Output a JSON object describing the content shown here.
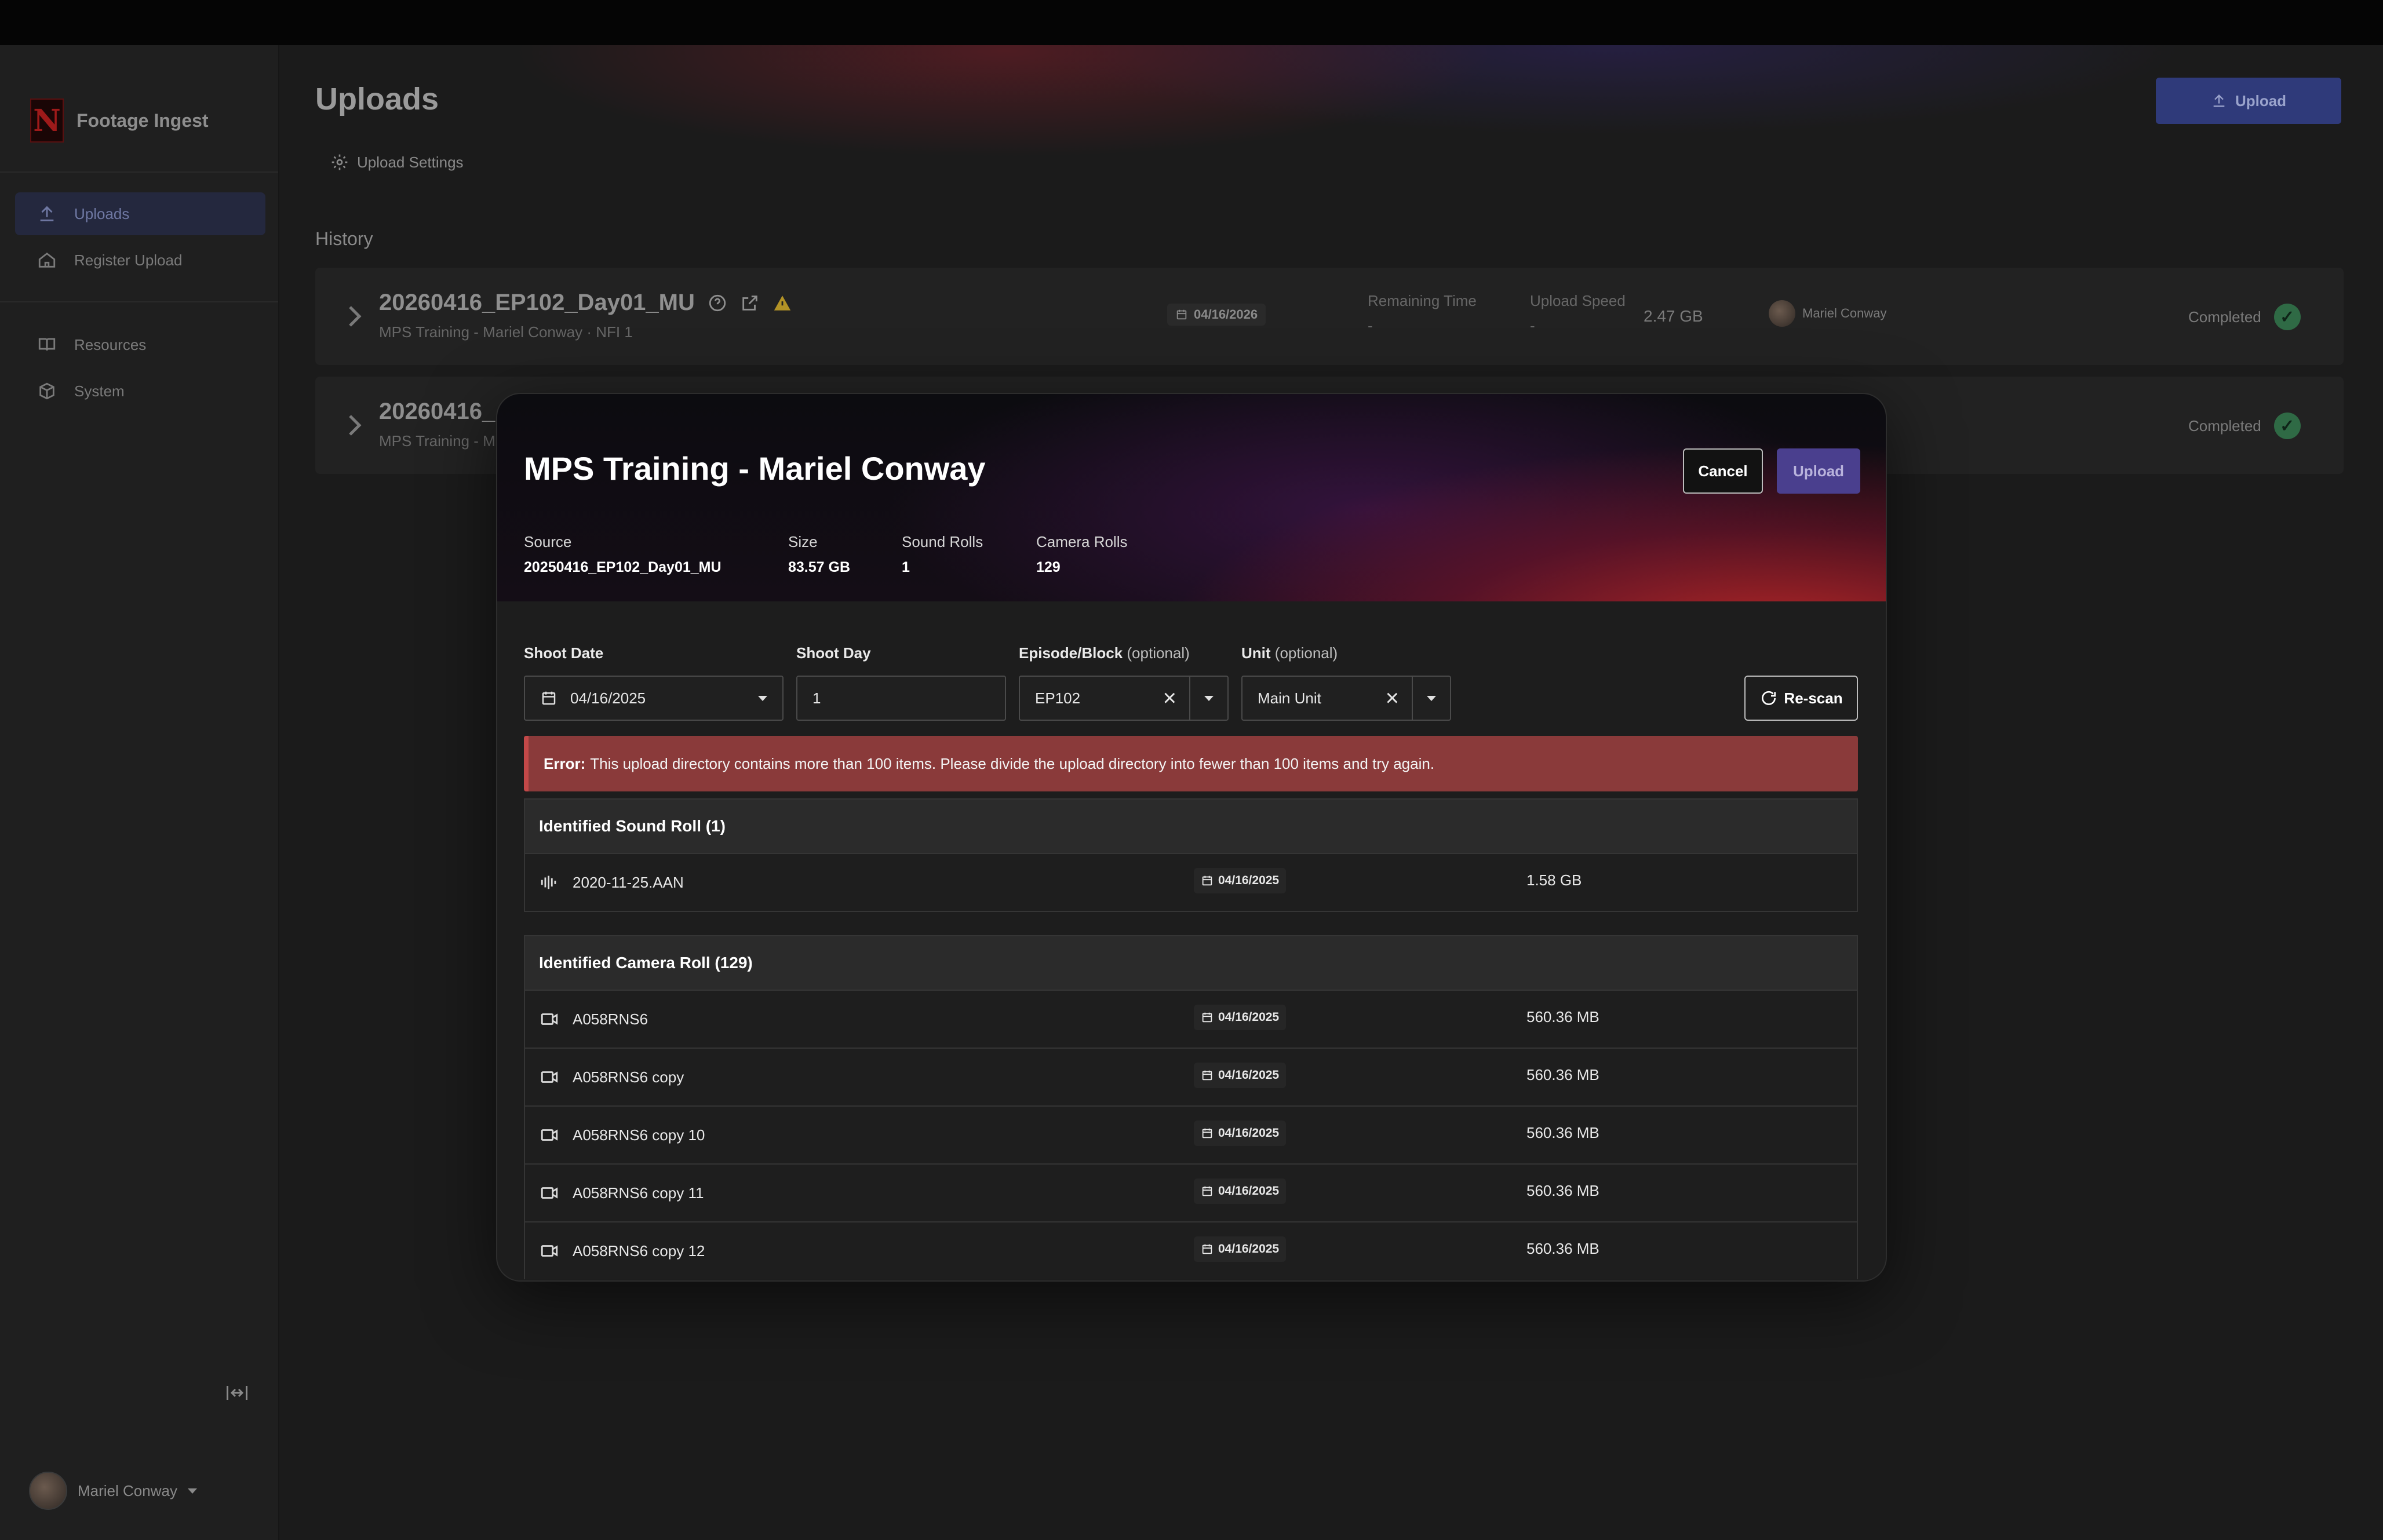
{
  "app": {
    "name": "Footage Ingest"
  },
  "sidebar": {
    "items": [
      {
        "label": "Uploads",
        "icon": "upload-icon",
        "active": true
      },
      {
        "label": "Register Upload",
        "icon": "home-icon",
        "active": false
      },
      {
        "label": "Resources",
        "icon": "book-icon",
        "active": false
      },
      {
        "label": "System",
        "icon": "cube-icon",
        "active": false
      }
    ],
    "user": "Mariel Conway"
  },
  "page": {
    "title": "Uploads",
    "upload_button": "Upload",
    "settings_label": "Upload Settings",
    "history_label": "History"
  },
  "history": [
    {
      "name": "20260416_EP102_Day01_MU",
      "subtitle": "MPS Training - Mariel Conway · NFI 1",
      "date": "04/16/2026",
      "remaining_label": "Remaining Time",
      "remaining_value": "-",
      "speed_label": "Upload Speed",
      "speed_value": "-",
      "size": "2.47 GB",
      "user": "Mariel Conway",
      "status": "Completed"
    },
    {
      "name": "20260416_",
      "subtitle": "MPS Training - M",
      "status": "Completed"
    }
  ],
  "modal": {
    "title": "MPS Training - Mariel Conway",
    "cancel": "Cancel",
    "upload": "Upload",
    "meta": {
      "source_label": "Source",
      "source_value": "20250416_EP102_Day01_MU",
      "size_label": "Size",
      "size_value": "83.57 GB",
      "sound_label": "Sound Rolls",
      "sound_value": "1",
      "camera_label": "Camera Rolls",
      "camera_value": "129"
    },
    "fields": {
      "shoot_date_label": "Shoot Date",
      "shoot_date_value": "04/16/2025",
      "shoot_day_label": "Shoot Day",
      "shoot_day_value": "1",
      "episode_label": "Episode/Block",
      "episode_opt": "(optional)",
      "episode_value": "EP102",
      "unit_label": "Unit",
      "unit_opt": "(optional)",
      "unit_value": "Main Unit",
      "rescan": "Re-scan"
    },
    "error": {
      "prefix": "Error:",
      "message": "This upload directory contains more than 100 items. Please divide the upload directory into fewer than 100 items and try again."
    },
    "sound_section": {
      "title": "Identified Sound Roll (1)",
      "rows": [
        {
          "name": "2020-11-25.AAN",
          "date": "04/16/2025",
          "size": "1.58 GB"
        }
      ]
    },
    "camera_section": {
      "title": "Identified Camera Roll (129)",
      "rows": [
        {
          "name": "A058RNS6",
          "date": "04/16/2025",
          "size": "560.36 MB"
        },
        {
          "name": "A058RNS6 copy",
          "date": "04/16/2025",
          "size": "560.36 MB"
        },
        {
          "name": "A058RNS6 copy 10",
          "date": "04/16/2025",
          "size": "560.36 MB"
        },
        {
          "name": "A058RNS6 copy 11",
          "date": "04/16/2025",
          "size": "560.36 MB"
        },
        {
          "name": "A058RNS6 copy 12",
          "date": "04/16/2025",
          "size": "560.36 MB"
        }
      ]
    }
  }
}
